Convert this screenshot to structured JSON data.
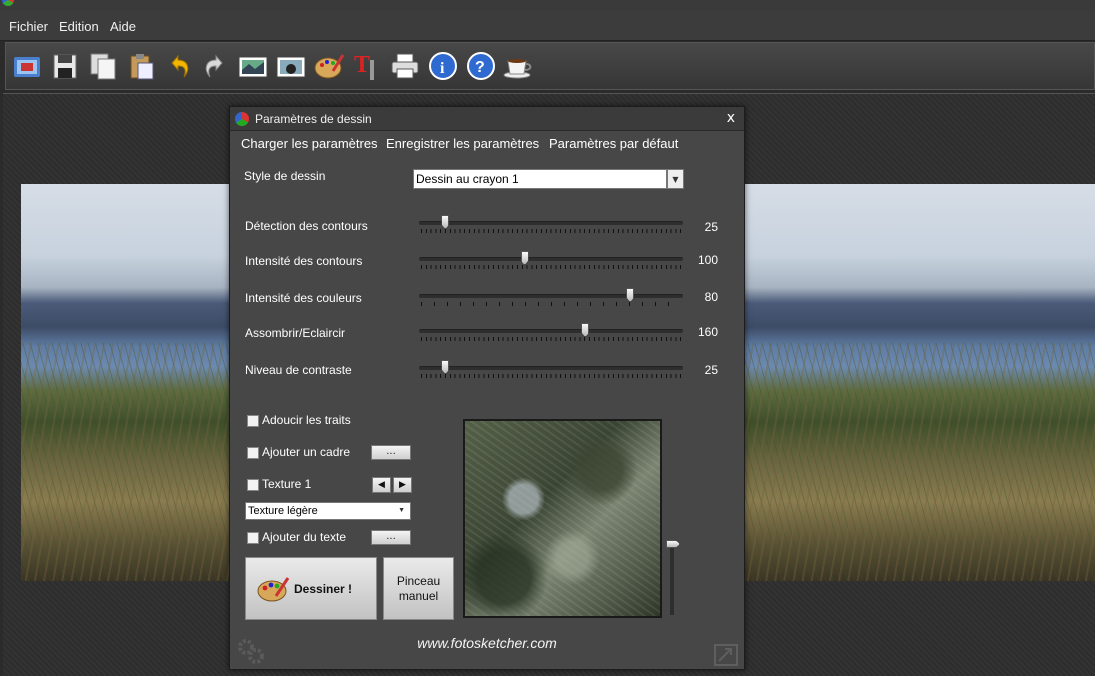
{
  "menubar": {
    "items": [
      "Fichier",
      "Edition",
      "Aide"
    ]
  },
  "toolbar": {
    "buttons": [
      "open-image-icon",
      "save-icon",
      "copy-icon",
      "paste-icon",
      "undo-icon",
      "redo-icon",
      "image-filter-icon",
      "image-effect-icon",
      "palette-icon",
      "text-tool-icon",
      "print-icon",
      "info-icon",
      "help-icon",
      "coffee-icon"
    ]
  },
  "dialog": {
    "title": "Paramètres de dessin",
    "close": "x",
    "menu": [
      "Charger les paramètres",
      "Enregistrer les paramètres",
      "Paramètres par défaut"
    ],
    "style_label": "Style de dessin",
    "style_value": "Dessin au crayon 1",
    "sliders": [
      {
        "label": "Détection des contours",
        "value": "25",
        "fraction": 0.1
      },
      {
        "label": "Intensité des contours",
        "value": "100",
        "fraction": 0.4
      },
      {
        "label": "Intensité des couleurs",
        "value": "80",
        "fraction": 0.8
      },
      {
        "label": "Assombrir/Eclaircir",
        "value": "160",
        "fraction": 0.63
      },
      {
        "label": "Niveau de contraste",
        "value": "25",
        "fraction": 0.1
      }
    ],
    "checkboxes": {
      "smooth": "Adoucir les traits",
      "frame": "Ajouter un cadre",
      "texture": "Texture 1",
      "text": "Ajouter du texte"
    },
    "ellipsis": "...",
    "texture_select": "Texture légère",
    "draw_button": "Dessiner !",
    "manual_brush_line1": "Pinceau",
    "manual_brush_line2": "manuel",
    "website": "www.fotosketcher.com"
  }
}
